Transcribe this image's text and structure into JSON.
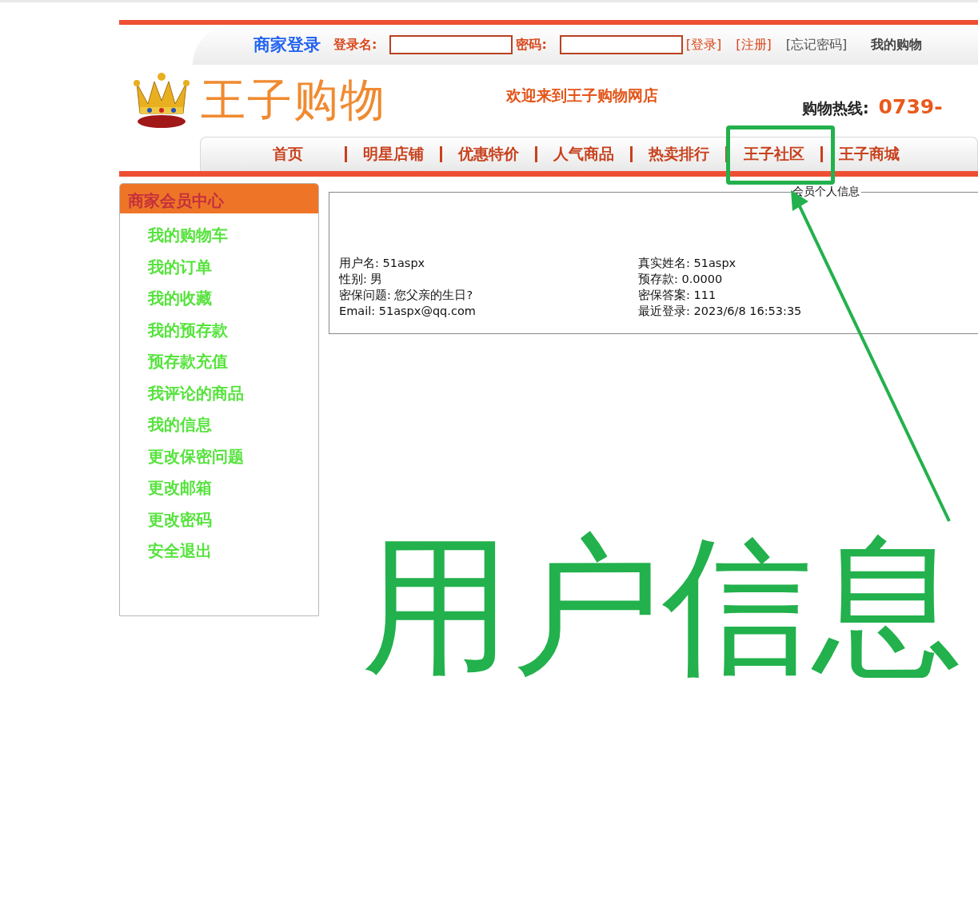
{
  "top_bar": {
    "title": "商家登录",
    "username_label": "登录名:",
    "password_label": "密码:",
    "links": [
      {
        "label": "[登录]",
        "kind": "action"
      },
      {
        "label": "[注册]",
        "kind": "action"
      },
      {
        "label": "[忘记密码]",
        "kind": "muted"
      },
      {
        "label": "我的购物",
        "kind": "plain"
      }
    ]
  },
  "header": {
    "logo_text": "王子购物",
    "welcome": "欢迎来到王子购物网店",
    "hotline_label": "购物热线:",
    "hotline_number": "0739-"
  },
  "nav": [
    "首页",
    "明星店铺",
    "优惠特价",
    "人气商品",
    "热卖排行",
    "王子社区",
    "王子商城"
  ],
  "sidebar": {
    "title": "商家会员中心",
    "items": [
      "我的购物车",
      "我的订单",
      "我的收藏",
      "我的预存款",
      "预存款充值",
      "我评论的商品",
      "我的信息",
      "更改保密问题",
      "更改邮箱",
      "更改密码",
      "安全退出"
    ]
  },
  "member_info": {
    "title": "会员个人信息",
    "left": [
      "用户名: 51aspx",
      "性别: 男",
      "密保问题: 您父亲的生日?",
      "Email: 51aspx@qq.com"
    ],
    "right": [
      "真实姓名: 51aspx",
      "预存款: 0.0000",
      "密保答案: 111",
      "最近登录: 2023/6/8 16:53:35"
    ]
  },
  "annotation": {
    "text": "用户信息"
  }
}
